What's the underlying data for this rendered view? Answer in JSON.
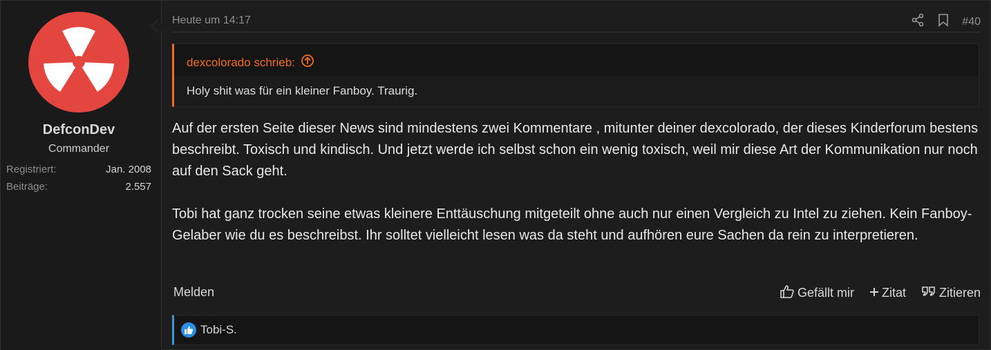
{
  "user": {
    "name": "DefconDev",
    "title": "Commander",
    "stats": [
      {
        "label": "Registriert:",
        "value": "Jan. 2008"
      },
      {
        "label": "Beiträge:",
        "value": "2.557"
      }
    ],
    "avatar_colors": {
      "primary": "#e3463f",
      "secondary": "#ffffff"
    }
  },
  "post": {
    "time": "Heute um 14:17",
    "number": "#40",
    "quote": {
      "author_line": "dexcolorado schrieb:",
      "text": "Holy shit was für ein kleiner Fanboy. Traurig."
    },
    "paragraphs": [
      "Auf der ersten Seite dieser News sind mindestens zwei Kommentare , mitunter deiner dexcolorado, der dieses Kinderforum bestens beschreibt. Toxisch und kindisch. Und jetzt werde ich selbst schon ein wenig toxisch, weil mir diese Art der Kommunikation nur noch auf den Sack geht.",
      "Tobi hat ganz trocken seine etwas kleinere Enttäuschung mitgeteilt ohne auch nur einen Vergleich zu Intel zu ziehen. Kein Fanboy-Gelaber wie du es beschreibst. Ihr solltet vielleicht lesen was da steht und aufhören eure Sachen da rein zu interpretieren."
    ]
  },
  "footer": {
    "report": "Melden",
    "like": "Gefällt mir",
    "zitat": "Zitat",
    "zitieren": "Zitieren"
  },
  "likes": {
    "names": "Tobi-S."
  },
  "colors": {
    "accent_quote": "#f36c22",
    "accent_like": "#3a9ad9",
    "like_badge": "#2d8ee6"
  },
  "icons": [
    "share-icon",
    "bookmark-icon",
    "arrow-up-circle-icon",
    "thumbs-up-icon",
    "plus-icon",
    "quote-icon",
    "like-badge-icon"
  ]
}
